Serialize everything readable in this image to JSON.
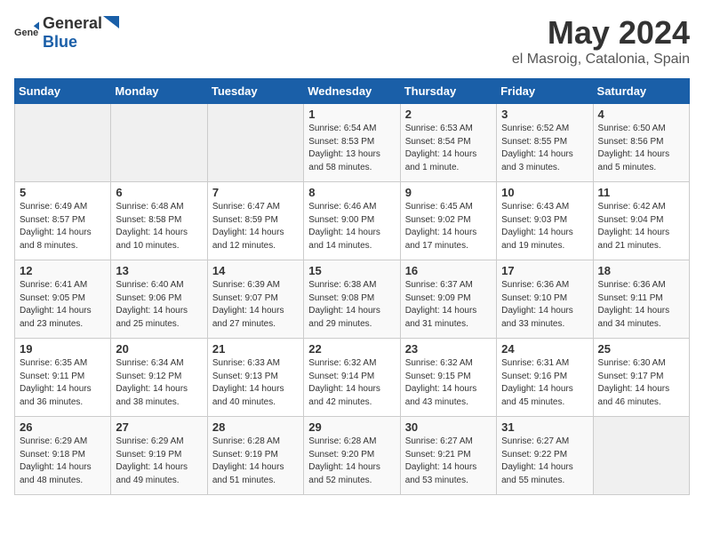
{
  "logo": {
    "text_general": "General",
    "text_blue": "Blue"
  },
  "header": {
    "month_year": "May 2024",
    "location": "el Masroig, Catalonia, Spain"
  },
  "days_of_week": [
    "Sunday",
    "Monday",
    "Tuesday",
    "Wednesday",
    "Thursday",
    "Friday",
    "Saturday"
  ],
  "weeks": [
    [
      {
        "day": "",
        "info": ""
      },
      {
        "day": "",
        "info": ""
      },
      {
        "day": "",
        "info": ""
      },
      {
        "day": "1",
        "info": "Sunrise: 6:54 AM\nSunset: 8:53 PM\nDaylight: 13 hours\nand 58 minutes."
      },
      {
        "day": "2",
        "info": "Sunrise: 6:53 AM\nSunset: 8:54 PM\nDaylight: 14 hours\nand 1 minute."
      },
      {
        "day": "3",
        "info": "Sunrise: 6:52 AM\nSunset: 8:55 PM\nDaylight: 14 hours\nand 3 minutes."
      },
      {
        "day": "4",
        "info": "Sunrise: 6:50 AM\nSunset: 8:56 PM\nDaylight: 14 hours\nand 5 minutes."
      }
    ],
    [
      {
        "day": "5",
        "info": "Sunrise: 6:49 AM\nSunset: 8:57 PM\nDaylight: 14 hours\nand 8 minutes."
      },
      {
        "day": "6",
        "info": "Sunrise: 6:48 AM\nSunset: 8:58 PM\nDaylight: 14 hours\nand 10 minutes."
      },
      {
        "day": "7",
        "info": "Sunrise: 6:47 AM\nSunset: 8:59 PM\nDaylight: 14 hours\nand 12 minutes."
      },
      {
        "day": "8",
        "info": "Sunrise: 6:46 AM\nSunset: 9:00 PM\nDaylight: 14 hours\nand 14 minutes."
      },
      {
        "day": "9",
        "info": "Sunrise: 6:45 AM\nSunset: 9:02 PM\nDaylight: 14 hours\nand 17 minutes."
      },
      {
        "day": "10",
        "info": "Sunrise: 6:43 AM\nSunset: 9:03 PM\nDaylight: 14 hours\nand 19 minutes."
      },
      {
        "day": "11",
        "info": "Sunrise: 6:42 AM\nSunset: 9:04 PM\nDaylight: 14 hours\nand 21 minutes."
      }
    ],
    [
      {
        "day": "12",
        "info": "Sunrise: 6:41 AM\nSunset: 9:05 PM\nDaylight: 14 hours\nand 23 minutes."
      },
      {
        "day": "13",
        "info": "Sunrise: 6:40 AM\nSunset: 9:06 PM\nDaylight: 14 hours\nand 25 minutes."
      },
      {
        "day": "14",
        "info": "Sunrise: 6:39 AM\nSunset: 9:07 PM\nDaylight: 14 hours\nand 27 minutes."
      },
      {
        "day": "15",
        "info": "Sunrise: 6:38 AM\nSunset: 9:08 PM\nDaylight: 14 hours\nand 29 minutes."
      },
      {
        "day": "16",
        "info": "Sunrise: 6:37 AM\nSunset: 9:09 PM\nDaylight: 14 hours\nand 31 minutes."
      },
      {
        "day": "17",
        "info": "Sunrise: 6:36 AM\nSunset: 9:10 PM\nDaylight: 14 hours\nand 33 minutes."
      },
      {
        "day": "18",
        "info": "Sunrise: 6:36 AM\nSunset: 9:11 PM\nDaylight: 14 hours\nand 34 minutes."
      }
    ],
    [
      {
        "day": "19",
        "info": "Sunrise: 6:35 AM\nSunset: 9:11 PM\nDaylight: 14 hours\nand 36 minutes."
      },
      {
        "day": "20",
        "info": "Sunrise: 6:34 AM\nSunset: 9:12 PM\nDaylight: 14 hours\nand 38 minutes."
      },
      {
        "day": "21",
        "info": "Sunrise: 6:33 AM\nSunset: 9:13 PM\nDaylight: 14 hours\nand 40 minutes."
      },
      {
        "day": "22",
        "info": "Sunrise: 6:32 AM\nSunset: 9:14 PM\nDaylight: 14 hours\nand 42 minutes."
      },
      {
        "day": "23",
        "info": "Sunrise: 6:32 AM\nSunset: 9:15 PM\nDaylight: 14 hours\nand 43 minutes."
      },
      {
        "day": "24",
        "info": "Sunrise: 6:31 AM\nSunset: 9:16 PM\nDaylight: 14 hours\nand 45 minutes."
      },
      {
        "day": "25",
        "info": "Sunrise: 6:30 AM\nSunset: 9:17 PM\nDaylight: 14 hours\nand 46 minutes."
      }
    ],
    [
      {
        "day": "26",
        "info": "Sunrise: 6:29 AM\nSunset: 9:18 PM\nDaylight: 14 hours\nand 48 minutes."
      },
      {
        "day": "27",
        "info": "Sunrise: 6:29 AM\nSunset: 9:19 PM\nDaylight: 14 hours\nand 49 minutes."
      },
      {
        "day": "28",
        "info": "Sunrise: 6:28 AM\nSunset: 9:19 PM\nDaylight: 14 hours\nand 51 minutes."
      },
      {
        "day": "29",
        "info": "Sunrise: 6:28 AM\nSunset: 9:20 PM\nDaylight: 14 hours\nand 52 minutes."
      },
      {
        "day": "30",
        "info": "Sunrise: 6:27 AM\nSunset: 9:21 PM\nDaylight: 14 hours\nand 53 minutes."
      },
      {
        "day": "31",
        "info": "Sunrise: 6:27 AM\nSunset: 9:22 PM\nDaylight: 14 hours\nand 55 minutes."
      },
      {
        "day": "",
        "info": ""
      }
    ]
  ]
}
